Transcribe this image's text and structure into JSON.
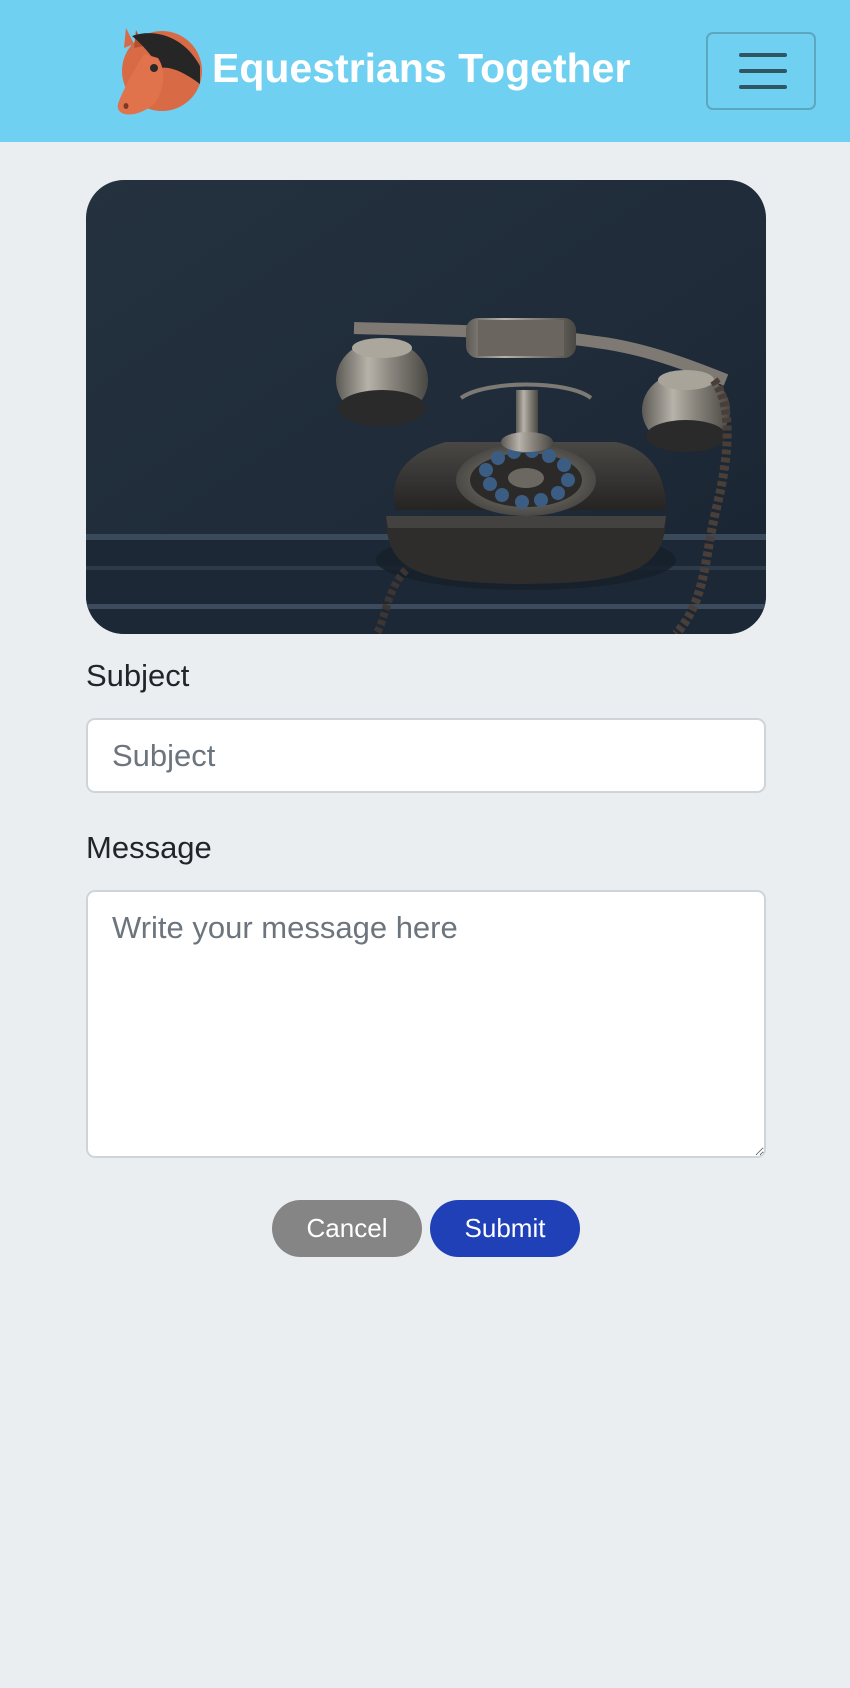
{
  "header": {
    "brand_name": "Equestrians Together",
    "logo_icon": "horse-head-icon",
    "menu_icon": "hamburger-menu-icon",
    "background_color": "#6fd0f1"
  },
  "hero_image": {
    "subject": "vintage rotary telephone"
  },
  "form": {
    "subject_label": "Subject",
    "subject_placeholder": "Subject",
    "subject_value": "",
    "message_label": "Message",
    "message_placeholder": "Write your message here",
    "message_value": ""
  },
  "actions": {
    "cancel_label": "Cancel",
    "cancel_color": "#858585",
    "submit_label": "Submit",
    "submit_color": "#1f40b7"
  }
}
